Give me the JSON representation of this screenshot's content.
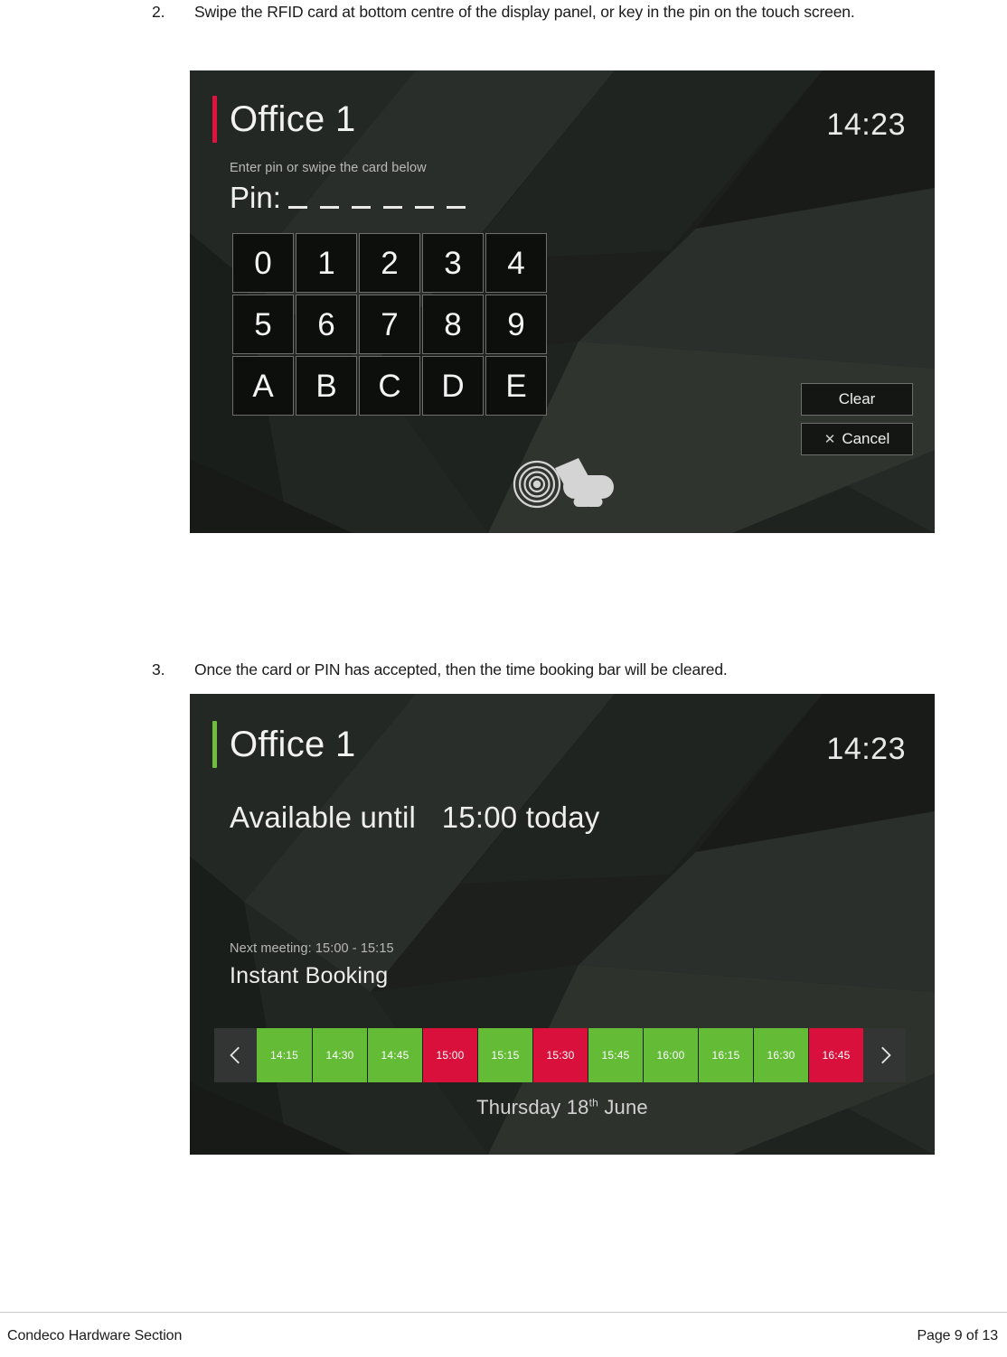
{
  "document": {
    "steps": [
      {
        "number": "2.",
        "text": "Swipe the RFID card at bottom centre of the display panel, or key in the pin on the touch screen."
      },
      {
        "number": "3.",
        "text": "Once the card or PIN has accepted, then the time booking bar will be cleared."
      }
    ],
    "footer": {
      "left": "Condeco Hardware Section",
      "right": "Page 9 of 13"
    }
  },
  "pin_panel": {
    "accent_color": "#e0133f",
    "room_name": "Office 1",
    "clock": "14:23",
    "hint": "Enter pin or swipe the card below",
    "pin_label": "Pin:",
    "pin_slot_count": 6,
    "keypad": [
      [
        "0",
        "1",
        "2",
        "3",
        "4"
      ],
      [
        "5",
        "6",
        "7",
        "8",
        "9"
      ],
      [
        "A",
        "B",
        "C",
        "D",
        "E"
      ]
    ],
    "buttons": {
      "clear": "Clear",
      "cancel": "Cancel",
      "cancel_icon": "close-icon"
    },
    "rfid_icon": "rfid-card-swipe-icon"
  },
  "available_panel": {
    "accent_color": "#6fbf3e",
    "room_name": "Office 1",
    "clock": "14:23",
    "status_prefix": "Available until",
    "status_time": "15:00 today",
    "next_meeting": "Next meeting: 15:00 - 15:15",
    "instant_booking": "Instant Booking",
    "prev_arrow_icon": "chevron-left-icon",
    "next_arrow_icon": "chevron-right-icon",
    "free_color": "#63bb36",
    "busy_color": "#d9103c",
    "slots": [
      {
        "time": "14:15",
        "state": "free"
      },
      {
        "time": "14:30",
        "state": "free"
      },
      {
        "time": "14:45",
        "state": "free"
      },
      {
        "time": "15:00",
        "state": "busy"
      },
      {
        "time": "15:15",
        "state": "free"
      },
      {
        "time": "15:30",
        "state": "busy"
      },
      {
        "time": "15:45",
        "state": "free"
      },
      {
        "time": "16:00",
        "state": "free"
      },
      {
        "time": "16:15",
        "state": "free"
      },
      {
        "time": "16:30",
        "state": "free"
      },
      {
        "time": "16:45",
        "state": "busy"
      }
    ],
    "date": {
      "weekday_and_day": "Thursday 18",
      "ordinal": "th",
      "month": "June"
    }
  }
}
